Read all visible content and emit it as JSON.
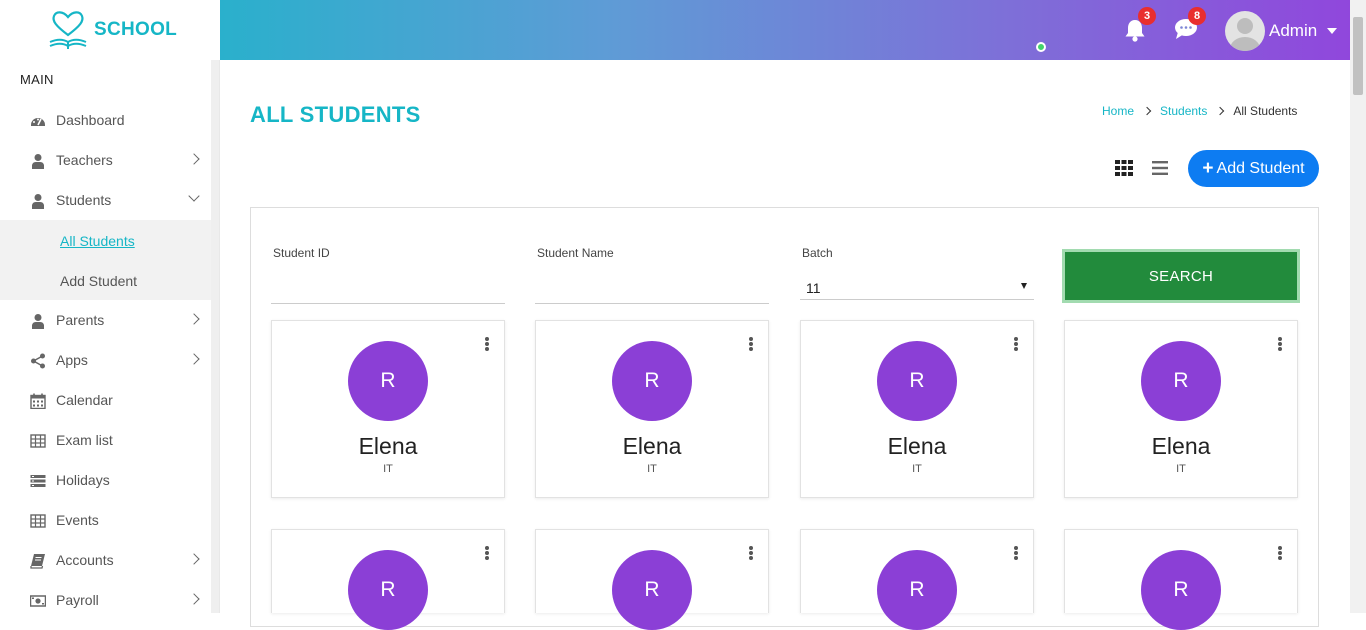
{
  "app": {
    "logo_text": "SCHOOL"
  },
  "header": {
    "notifications_count": "3",
    "messages_count": "8",
    "user_name": "Admin"
  },
  "sidebar": {
    "section_label": "MAIN",
    "items": [
      {
        "label": "Dashboard",
        "icon": "dashboard-icon"
      },
      {
        "label": "Teachers",
        "icon": "user-icon"
      },
      {
        "label": "Students",
        "icon": "user-icon"
      },
      {
        "label": "Parents",
        "icon": "user-icon"
      },
      {
        "label": "Apps",
        "icon": "share-icon"
      },
      {
        "label": "Calendar",
        "icon": "calendar-icon"
      },
      {
        "label": "Exam list",
        "icon": "table-icon"
      },
      {
        "label": "Holidays",
        "icon": "list-icon"
      },
      {
        "label": "Events",
        "icon": "table-icon"
      },
      {
        "label": "Accounts",
        "icon": "book-icon"
      },
      {
        "label": "Payroll",
        "icon": "money-icon"
      }
    ],
    "students_submenu": [
      {
        "label": "All Students",
        "active": true
      },
      {
        "label": "Add Student",
        "active": false
      }
    ]
  },
  "page": {
    "title": "ALL STUDENTS",
    "breadcrumb": [
      "Home",
      "Students",
      "All Students"
    ],
    "add_button_label": "Add Student"
  },
  "filters": {
    "student_id_label": "Student ID",
    "student_id_value": "",
    "student_name_label": "Student Name",
    "student_name_value": "",
    "batch_label": "Batch",
    "batch_value": "11",
    "search_button_label": "SEARCH"
  },
  "students": [
    {
      "initial": "R",
      "name": "Elena",
      "department": "IT"
    },
    {
      "initial": "R",
      "name": "Elena",
      "department": "IT"
    },
    {
      "initial": "R",
      "name": "Elena",
      "department": "IT"
    },
    {
      "initial": "R",
      "name": "Elena",
      "department": "IT"
    },
    {
      "initial": "R",
      "name": "",
      "department": ""
    },
    {
      "initial": "R",
      "name": "",
      "department": ""
    },
    {
      "initial": "R",
      "name": "",
      "department": ""
    },
    {
      "initial": "R",
      "name": "",
      "department": ""
    }
  ],
  "colors": {
    "accent": "#16b6c6",
    "avatar_bg": "#8b3fd6",
    "search_button": "#228b3c",
    "add_button": "#0d7cf2",
    "badge": "#e92e2e"
  }
}
